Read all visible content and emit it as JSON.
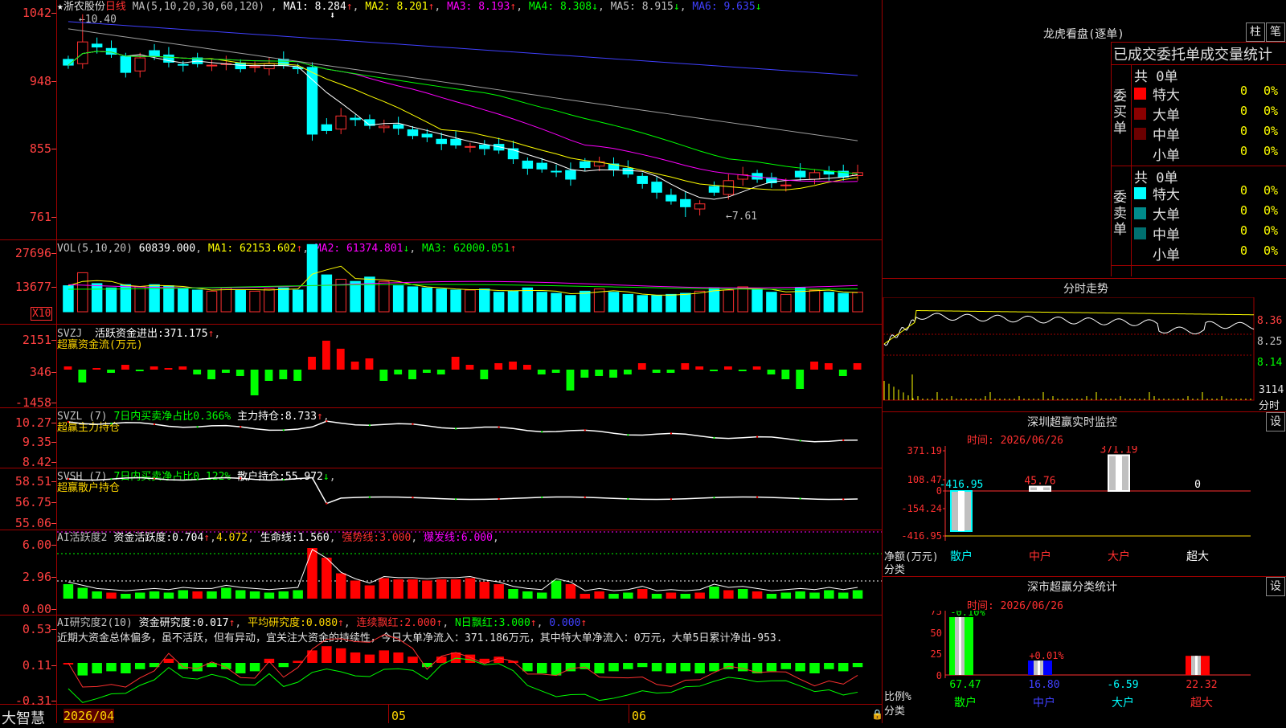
{
  "stock": {
    "name": "浙农股份",
    "period": "日线",
    "star": "★"
  },
  "main": {
    "ma_def": "MA(5,10,20,30,60,120)",
    "ma": [
      {
        "label": "MA1:",
        "value": "8.284",
        "arrow": "↑",
        "color": "#ffffff"
      },
      {
        "label": "MA2:",
        "value": "8.201",
        "arrow": "↑",
        "color": "#ffff00"
      },
      {
        "label": "MA3:",
        "value": "8.193",
        "arrow": "↑",
        "color": "#ff00ff"
      },
      {
        "label": "MA4:",
        "value": "8.308",
        "arrow": "↓",
        "color": "#00ff00"
      },
      {
        "label": "MA5:",
        "value": "8.915",
        "arrow": "↓",
        "color": "#c0c0c0"
      },
      {
        "label": "MA6:",
        "value": "9.635",
        "arrow": "↓",
        "color": "#4040ff"
      }
    ],
    "y_labels": [
      "1042",
      "948",
      "855",
      "761"
    ],
    "high_note": "10.40",
    "low_note": "7.61"
  },
  "vol": {
    "def": "VOL(5,10,20)",
    "value": "60839.000",
    "ma": [
      {
        "label": "MA1:",
        "value": "62153.602",
        "arrow": "↑",
        "color": "#ffff00"
      },
      {
        "label": "MA2:",
        "value": "61374.801",
        "arrow": "↓",
        "color": "#ff00ff"
      },
      {
        "label": "MA3:",
        "value": "62000.051",
        "arrow": "↑",
        "color": "#00ff00"
      }
    ],
    "y_labels": [
      "27696",
      "13677"
    ],
    "unit": "X10"
  },
  "svzj": {
    "def": "SVZJ",
    "label": "活跃资金进出:",
    "value": "371.175",
    "arrow": "↑",
    "sub": "超赢资金流(万元)",
    "y_labels": [
      "2151",
      "346",
      "-1458"
    ]
  },
  "svzl": {
    "def": "SVZL (7)",
    "text1": "7日内买卖净占比0.366%",
    "label": "主力持仓:",
    "value": "8.733",
    "arrow": "↑",
    "sub": "超赢主力持仓",
    "y_labels": [
      "10.27",
      "9.35",
      "8.42"
    ]
  },
  "svsh": {
    "def": "SVSH (7)",
    "text1": "7日内买卖净占比0.122%",
    "label": "散户持仓:",
    "value": "55.972",
    "arrow": "↓",
    "sub": "超赢散户持仓",
    "y_labels": [
      "58.51",
      "56.75",
      "55.06"
    ]
  },
  "ai1": {
    "def": "AI活跃度2",
    "label": "资金活跃度:",
    "value": "0.704",
    "arrow": "↑",
    "value2": "4.072",
    "life_label": "生命线:",
    "life": "1.560",
    "strong_label": "强势线:",
    "strong": "3.000",
    "burst_label": "爆发线:",
    "burst": "6.000",
    "y_labels": [
      "6.00",
      "2.96",
      "0.00"
    ]
  },
  "ai2": {
    "def": "AI研究度2(10)",
    "label": "资金研究度:",
    "value": "0.017",
    "avg_label": "平均研究度:",
    "avg": "0.080",
    "red_label": "连续飘红:",
    "red": "2.000",
    "n_label": "N日飘红:",
    "n": "3.000",
    "last": "0.000",
    "comment": "近期大资金总体偏多，虽不活跃，但有异动，宜关注大资金的持续性，今日大单净流入：371.186万元，其中特大单净流入：0万元，大单5日累计净出-953.",
    "y_labels": [
      "0.53",
      "0.11",
      "-0.31"
    ]
  },
  "xaxis": {
    "labels": [
      "2026/04",
      "05",
      "06"
    ],
    "brand": "大智慧"
  },
  "right": {
    "lh_title": "龙虎看盘(逐单)",
    "btn_zhu": "柱",
    "btn_bi": "笔",
    "stat_title": "已成交委托单成交量统计",
    "buy_side": "委买单",
    "sell_side": "委卖单",
    "buy_total": "共 0单",
    "sell_total": "共 0单",
    "buy_rows": [
      {
        "name": "特大",
        "val": "0",
        "pct": "0%",
        "color": "#ff0000"
      },
      {
        "name": "大单",
        "val": "0",
        "pct": "0%",
        "color": "#8b0000"
      },
      {
        "name": "中单",
        "val": "0",
        "pct": "0%",
        "color": "#6b0000"
      },
      {
        "name": "小单",
        "val": "0",
        "pct": "0%",
        "color": ""
      }
    ],
    "sell_rows": [
      {
        "name": "特大",
        "val": "0",
        "pct": "0%",
        "color": "#00ffff"
      },
      {
        "name": "大单",
        "val": "0",
        "pct": "0%",
        "color": "#008b8b"
      },
      {
        "name": "中单",
        "val": "0",
        "pct": "0%",
        "color": "#007070"
      },
      {
        "name": "小单",
        "val": "0",
        "pct": "0%",
        "color": ""
      }
    ],
    "intraday_title": "分时走势",
    "intraday_y": [
      "8.36",
      "8.25",
      "8.14"
    ],
    "intraday_vol": "3114",
    "intraday_unit": "分时",
    "monitor_title": "深圳超赢实时监控",
    "monitor_btn": "设",
    "monitor_time": "时间: 2026/06/26",
    "monitor_y": [
      "371.19",
      "108.47",
      "0",
      "-154.24",
      "-416.95"
    ],
    "monitor_ylabel": "净额(万元)",
    "monitor_cat": "分类",
    "monitor_bars": [
      {
        "cat": "散户",
        "value": -416.95,
        "label": "-416.95"
      },
      {
        "cat": "中户",
        "value": 45.76,
        "label": "45.76"
      },
      {
        "cat": "大户",
        "value": 371.19,
        "label": "371.19"
      },
      {
        "cat": "超大",
        "value": 0,
        "label": "0"
      }
    ],
    "class_title": "深市超赢分类统计",
    "class_btn": "设",
    "class_time": "时间: 2026/06/26",
    "class_y": [
      "75",
      "50",
      "25",
      "0"
    ],
    "class_ylabel": "比例%",
    "class_cat": "分类",
    "class_bars": [
      {
        "cat": "散户",
        "value": 67.47,
        "top": "-0.10%",
        "bottom": "67.47"
      },
      {
        "cat": "中户",
        "value": 16.8,
        "top": "+0.01%",
        "bottom": "16.80"
      },
      {
        "cat": "大户",
        "value": -6.59,
        "top": "",
        "bottom": "-6.59"
      },
      {
        "cat": "超大",
        "value": 22.32,
        "top": "",
        "bottom": "22.32"
      }
    ]
  },
  "chart_data": {
    "type": "candlestick",
    "title": "浙农股份 日线",
    "closes": [
      9.7,
      10.02,
      9.95,
      9.85,
      9.6,
      9.8,
      9.82,
      9.74,
      9.7,
      9.72,
      9.7,
      9.72,
      9.65,
      9.68,
      9.72,
      9.7,
      9.65,
      8.75,
      8.8,
      9.0,
      8.95,
      8.87,
      8.86,
      8.83,
      8.73,
      8.71,
      8.62,
      8.6,
      8.58,
      8.55,
      8.53,
      8.41,
      8.28,
      8.27,
      8.23,
      8.13,
      8.29,
      8.37,
      8.26,
      8.2,
      8.07,
      7.95,
      7.83,
      7.75,
      7.79,
      7.95,
      8.11,
      8.19,
      8.13,
      8.08,
      8.05,
      8.16,
      8.22,
      8.2,
      8.16,
      8.22
    ]
  }
}
